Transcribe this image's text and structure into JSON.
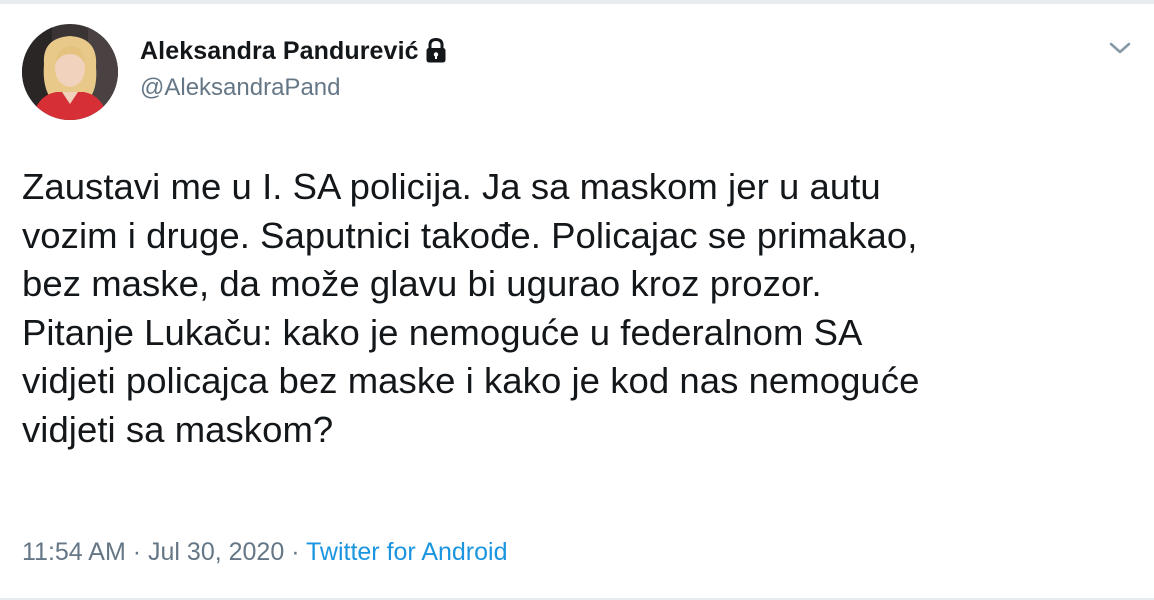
{
  "tweet": {
    "display_name": "Aleksandra Pandurević",
    "handle": "@AleksandraPand",
    "protected_icon": "lock-icon",
    "menu_icon": "chevron-down-icon",
    "text": "Zaustavi me u I. SA policija. Ja sa maskom jer u autu\nvozim i druge. Saputnici takođe. Policajac se primakao,\nbez maske, da može glavu bi ugurao kroz prozor.\nPitanje Lukaču: kako je nemoguće u federalnom SA\nvidjeti policajca bez maske i kako je kod nas nemoguće\nvidjeti sa maskom?",
    "time": "11:54 AM",
    "separator": "·",
    "date": "Jul 30, 2020",
    "source": "Twitter for Android"
  },
  "colors": {
    "text": "#14171a",
    "secondary": "#657786",
    "link": "#1b95e0"
  }
}
